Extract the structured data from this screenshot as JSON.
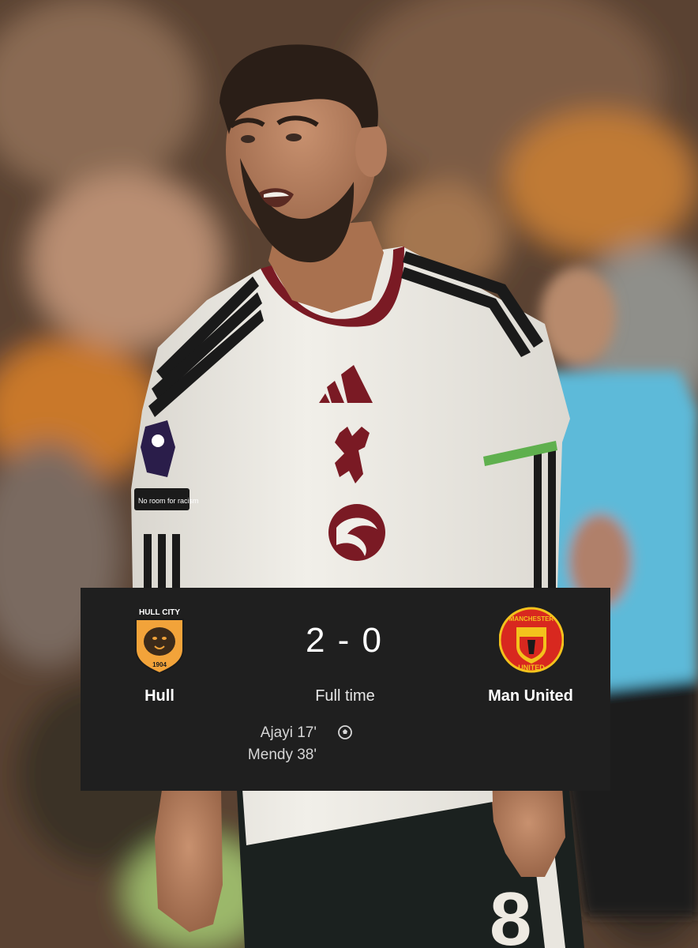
{
  "match": {
    "home_team": "Hull",
    "away_team": "Man United",
    "score": "2 - 0",
    "status": "Full time",
    "home_crest_text": "HULL CITY",
    "home_crest_year": "1904",
    "away_crest_text_top": "MANCHESTER",
    "away_crest_text_bottom": "UNITED",
    "scorers": [
      {
        "text": "Ajayi 17'"
      },
      {
        "text": "Mendy 38'"
      }
    ]
  },
  "photo": {
    "kit_badge_text": "No room for racism",
    "shirt_number": "8",
    "colors": {
      "scoreboard_bg": "#1f1f1f",
      "shirt": "#ece9e2",
      "trim": "#7a1a24"
    }
  }
}
